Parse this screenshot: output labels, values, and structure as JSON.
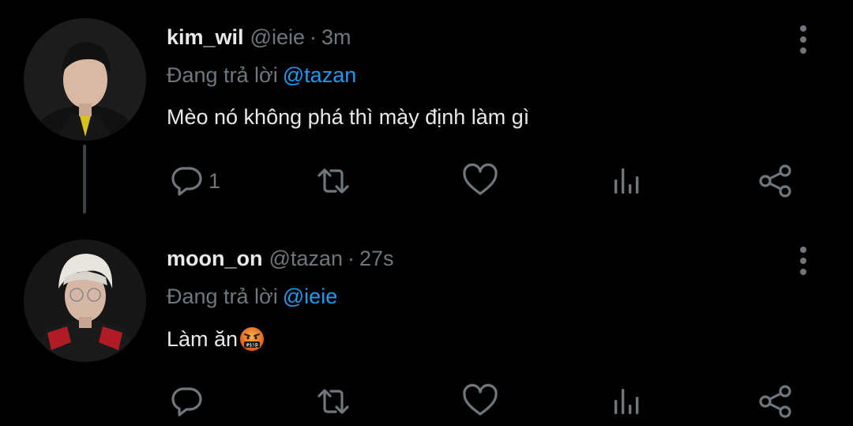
{
  "tweets": [
    {
      "display_name": "kim_wil",
      "handle": "@ieie",
      "separator": "·",
      "time": "3m",
      "replying_prefix": "Đang trả lời",
      "replying_to": "@tazan",
      "text": "Mèo nó không phá thì mày định làm gì",
      "reply_count": "1",
      "avatar": "avatar-photo"
    },
    {
      "display_name": "moon_on",
      "handle": "@tazan",
      "separator": "·",
      "time": "27s",
      "replying_prefix": "Đang trả lời",
      "replying_to": "@ieie",
      "text": "Làm ăn",
      "text_emoji": "face-with-symbols-on-mouth-emoji",
      "reply_count": "",
      "avatar": "avatar-photo"
    }
  ],
  "icons": {
    "reply": "comment-bubble-icon",
    "retweet": "retweet-icon",
    "like": "heart-icon",
    "views": "analytics-bars-icon",
    "share": "share-icon",
    "more": "more-vertical-icon"
  },
  "colors": {
    "background": "#000000",
    "text": "#e7e9ea",
    "muted": "#71767b",
    "mention": "#1d9bf0",
    "thread_line": "#3e4144"
  }
}
